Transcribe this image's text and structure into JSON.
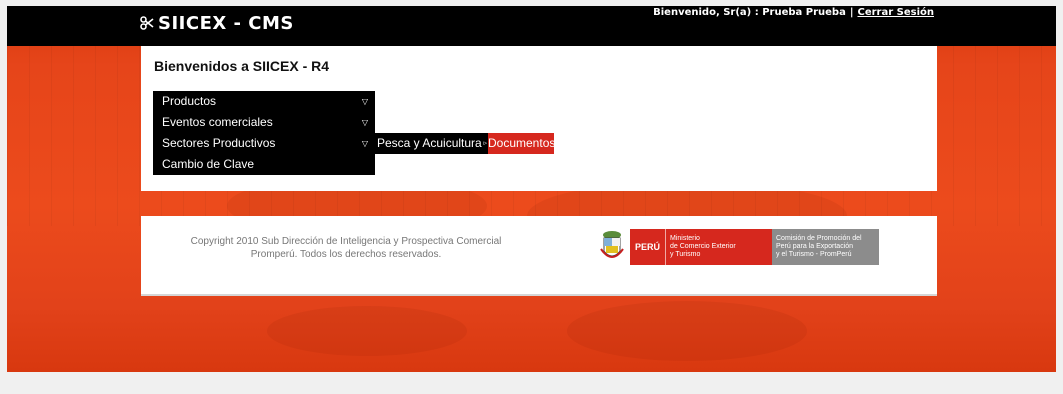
{
  "header": {
    "logo_text": "SIICEX - CMS",
    "welcome_text": "Bienvenido, Sr(a) : Prueba Prueba",
    "separator": "|",
    "logout_label": "Cerrar Sesión"
  },
  "main": {
    "title": "Bienvenidos a SIICEX - R4",
    "menu": [
      {
        "label": "Productos",
        "arrow": "▽"
      },
      {
        "label": "Eventos comerciales",
        "arrow": "▽"
      },
      {
        "label": "Sectores Productivos",
        "arrow": "▽"
      },
      {
        "label": "Cambio de Clave"
      }
    ],
    "submenu": {
      "item1_label": "Pesca y Acuicultura",
      "item1_arrow": "▹",
      "item2_label": "Documentos"
    }
  },
  "footer": {
    "copyright_line1": "Copyright 2010 Sub Dirección de Inteligencia y Prospectiva Comercial",
    "copyright_line2": "Promperú. Todos los derechos reservados.",
    "logo_peru_text": "PERÚ",
    "mincetur_lines": [
      "Ministerio",
      "de Comercio Exterior",
      "y Turismo"
    ],
    "promperu_lines": [
      "Comisión de Promoción del",
      "Perú para la Exportación",
      "y el Turismo - PromPerú"
    ]
  },
  "colors": {
    "brand_red": "#d6281e",
    "background_orange": "#e6451a",
    "header_black": "#000000"
  }
}
